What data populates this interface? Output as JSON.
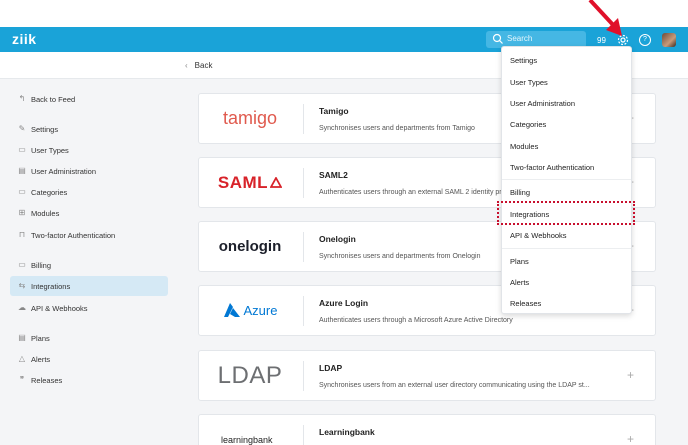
{
  "app": {
    "logo": "ziik"
  },
  "header": {
    "search_placeholder": "Search",
    "count": "99",
    "icons": [
      "search-icon",
      "gear-icon",
      "help-icon",
      "avatar"
    ],
    "accent_color": "#1aa3d8"
  },
  "subbar": {
    "back_label": "Back"
  },
  "sidebar": {
    "back_to_feed": "Back to Feed",
    "items": [
      {
        "label": "Settings",
        "icon": "wrench-icon"
      },
      {
        "label": "User Types",
        "icon": "id-card-icon"
      },
      {
        "label": "User Administration",
        "icon": "users-icon"
      },
      {
        "label": "Categories",
        "icon": "folder-icon"
      },
      {
        "label": "Modules",
        "icon": "modules-icon"
      },
      {
        "label": "Two-factor Authentication",
        "icon": "lock-icon"
      },
      {
        "label": "Billing",
        "icon": "billing-icon"
      },
      {
        "label": "Integrations",
        "icon": "integrations-icon",
        "active": true
      },
      {
        "label": "API & Webhooks",
        "icon": "cloud-icon"
      },
      {
        "label": "Plans",
        "icon": "plans-icon"
      },
      {
        "label": "Alerts",
        "icon": "alert-icon"
      },
      {
        "label": "Releases",
        "icon": "quote-icon"
      }
    ]
  },
  "integrations": [
    {
      "brand": "tamigo",
      "title": "Tamigo",
      "desc": "Synchronises users and departments from Tamigo"
    },
    {
      "brand": "SAML",
      "title": "SAML2",
      "desc": "Authenticates users through an external SAML 2 identity provider"
    },
    {
      "brand": "onelogin",
      "title": "Onelogin",
      "desc": "Synchronises users and departments from Onelogin"
    },
    {
      "brand": "Azure",
      "title": "Azure Login",
      "desc": "Authenticates users through a Microsoft Azure Active Directory"
    },
    {
      "brand": "LDAP",
      "title": "LDAP",
      "desc": "Synchronises users from an external user directory communicating using the LDAP st..."
    },
    {
      "brand": "learningbank",
      "title": "Learningbank",
      "desc": ""
    }
  ],
  "dropdown": {
    "items": [
      "Settings",
      "User Types",
      "User Administration",
      "Categories",
      "Modules",
      "Two-factor Authentication",
      "Billing",
      "Integrations",
      "API & Webhooks",
      "Plans",
      "Alerts",
      "Releases"
    ],
    "highlighted": "Integrations"
  }
}
